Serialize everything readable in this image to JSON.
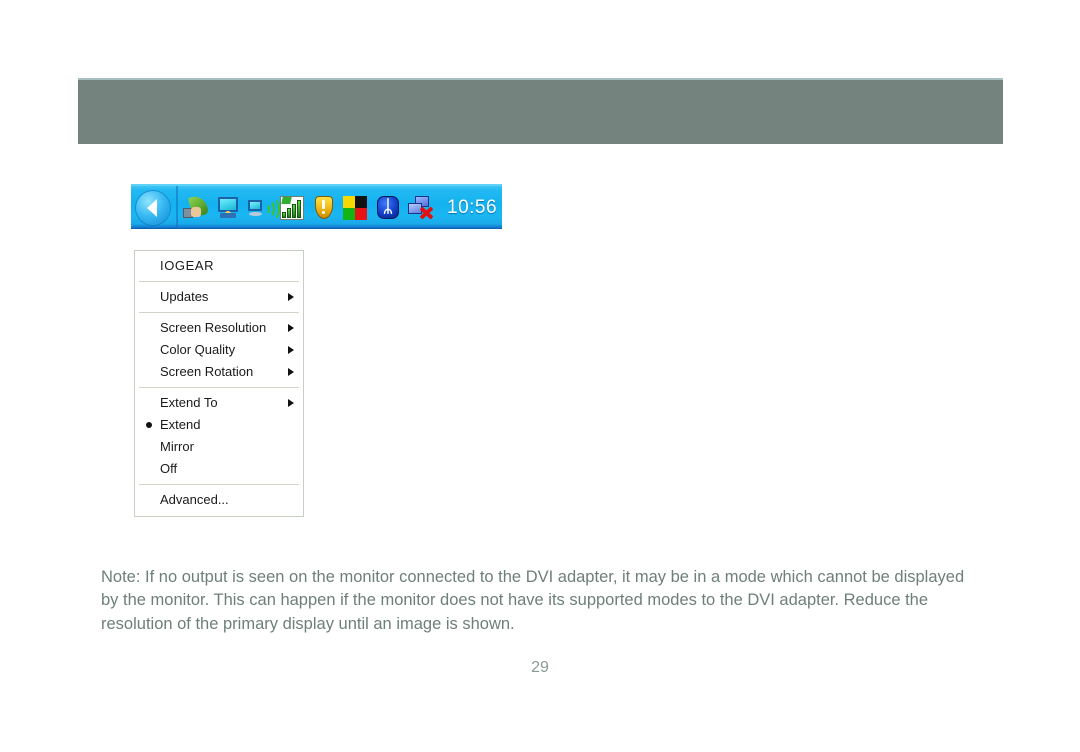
{
  "page": {
    "number": "29",
    "header_band_color": "#74837e",
    "note_text_color": "#6e7f79"
  },
  "note": {
    "text": "Note: If no output is seen on the monitor connected to the DVI adapter, it may be in a mode which cannot be displayed by the monitor. This can happen if the monitor does not have its supported modes to the DVI adapter. Reduce the resolution of the primary display until an image is shown."
  },
  "systray": {
    "clock": "10:56 AM",
    "show_hidden_icons": "show-hidden-icons-arrow",
    "icons": [
      {
        "name": "leaf-character-icon"
      },
      {
        "name": "monitor-icon"
      },
      {
        "name": "wireless-display-icon"
      },
      {
        "name": "signal-strength-icon"
      },
      {
        "name": "security-shield-warning-icon"
      },
      {
        "name": "windows-security-center-icon"
      },
      {
        "name": "bluetooth-icon",
        "glyph": "ᛦ"
      },
      {
        "name": "network-disconnected-icon"
      }
    ]
  },
  "context_menu": {
    "title": "IOGEAR",
    "groups": [
      {
        "items": [
          {
            "label": "Updates",
            "submenu": true,
            "selected": false
          }
        ]
      },
      {
        "items": [
          {
            "label": "Screen Resolution",
            "submenu": true,
            "selected": false
          },
          {
            "label": "Color Quality",
            "submenu": true,
            "selected": false
          },
          {
            "label": "Screen Rotation",
            "submenu": true,
            "selected": false
          }
        ]
      },
      {
        "items": [
          {
            "label": "Extend To",
            "submenu": true,
            "selected": false
          },
          {
            "label": "Extend",
            "submenu": false,
            "selected": true
          },
          {
            "label": "Mirror",
            "submenu": false,
            "selected": false
          },
          {
            "label": "Off",
            "submenu": false,
            "selected": false
          }
        ]
      },
      {
        "items": [
          {
            "label": "Advanced...",
            "submenu": false,
            "selected": false
          }
        ]
      }
    ]
  }
}
